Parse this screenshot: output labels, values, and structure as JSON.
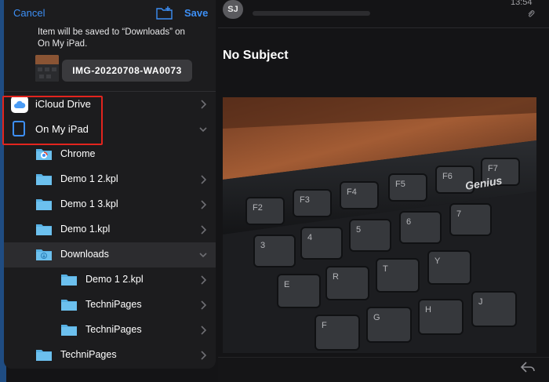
{
  "mail": {
    "sender_initials": "SJ",
    "time": "13:54",
    "subject": "No Subject",
    "photo_brand": "Genius",
    "keys": [
      {
        "label": "F2"
      },
      {
        "label": "F3"
      },
      {
        "label": "F4"
      },
      {
        "label": "F5"
      },
      {
        "label": "F6"
      },
      {
        "label": "F7"
      },
      {
        "label": "3"
      },
      {
        "label": "4"
      },
      {
        "label": "5"
      },
      {
        "label": "6"
      },
      {
        "label": "7"
      },
      {
        "label": "E"
      },
      {
        "label": "R"
      },
      {
        "label": "T"
      },
      {
        "label": "Y"
      },
      {
        "label": "F"
      },
      {
        "label": "G"
      },
      {
        "label": "H"
      },
      {
        "label": "J"
      }
    ]
  },
  "sheet": {
    "cancel_label": "Cancel",
    "save_label": "Save",
    "note_line1": "Item will be saved to “Downloads” on",
    "note_line2": "On My iPad.",
    "filename": "IMG-20220708-WA0073",
    "locations": [
      {
        "label": "iCloud Drive",
        "expanded": false
      },
      {
        "label": "On My iPad",
        "expanded": true
      }
    ],
    "folders": [
      {
        "label": "Chrome",
        "has_chevron": false,
        "selected": false
      },
      {
        "label": "Demo 1 2.kpl",
        "has_chevron": true,
        "selected": false
      },
      {
        "label": "Demo 1 3.kpl",
        "has_chevron": true,
        "selected": false
      },
      {
        "label": "Demo 1.kpl",
        "has_chevron": true,
        "selected": false
      },
      {
        "label": "Downloads",
        "has_chevron": true,
        "selected": true,
        "expanded": true
      },
      {
        "label": "Demo 1 2.kpl",
        "has_chevron": true,
        "selected": false
      },
      {
        "label": "TechniPages",
        "has_chevron": true,
        "selected": false
      },
      {
        "label": "TechniPages",
        "has_chevron": true,
        "selected": false
      },
      {
        "label": "TechniPages",
        "has_chevron": true,
        "selected": false
      }
    ]
  },
  "colors": {
    "accent": "#3d8ff5",
    "folder": "#57b0e3",
    "highlight_box": "#e2241e",
    "sheet_bg": "#1c1c1e"
  }
}
